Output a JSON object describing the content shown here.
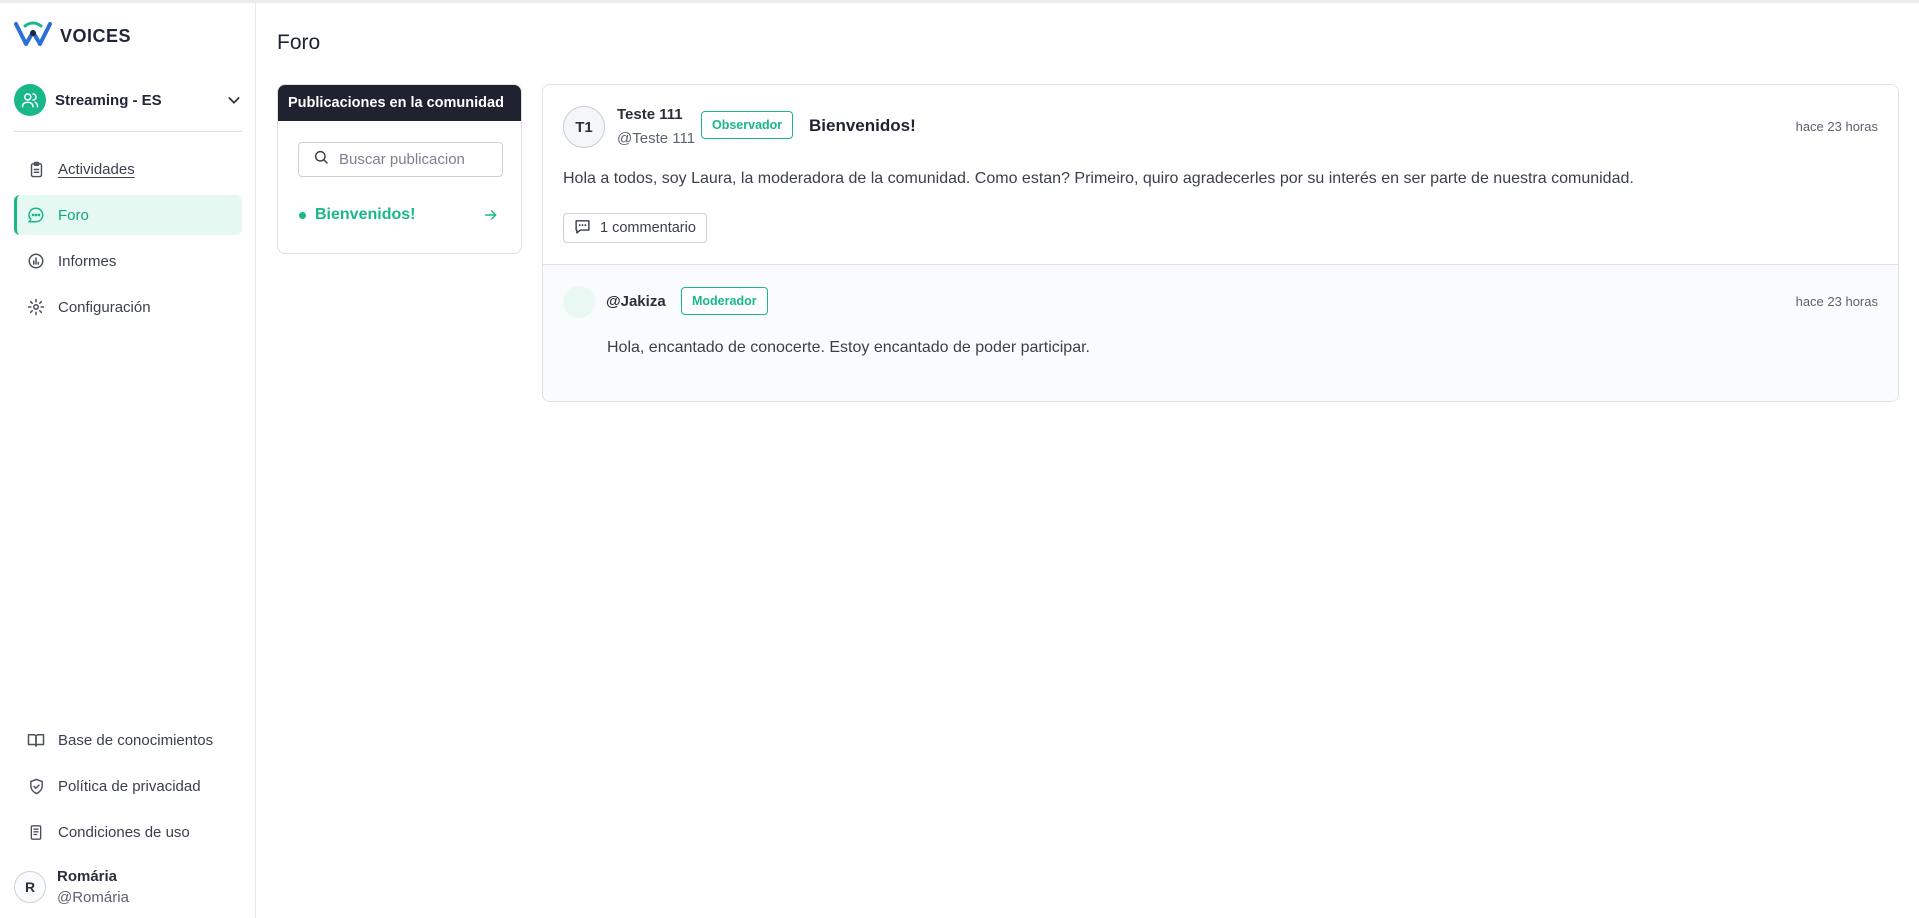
{
  "app": {
    "brand": "VOICES",
    "accent": "#19b78a",
    "dark": "#1f2330"
  },
  "sidebar": {
    "workspace": {
      "name": "Streaming - ES",
      "icon": "users-icon"
    },
    "nav": [
      {
        "label": "Actividades",
        "icon": "clipboard-icon",
        "active": false
      },
      {
        "label": "Foro",
        "icon": "chat-bubble-icon",
        "active": true
      },
      {
        "label": "Informes",
        "icon": "chart-circle-icon",
        "active": false
      },
      {
        "label": "Configuración",
        "icon": "gear-icon",
        "active": false
      }
    ],
    "footer_links": [
      {
        "label": "Base de conocimientos",
        "icon": "book-icon"
      },
      {
        "label": "Política de privacidad",
        "icon": "shield-icon"
      },
      {
        "label": "Condiciones de uso",
        "icon": "document-icon"
      }
    ],
    "user": {
      "initial": "R",
      "name": "Romária",
      "handle": "@Romária"
    }
  },
  "main": {
    "title": "Foro",
    "posts_panel": {
      "header": "Publicaciones en la comunidad",
      "search_placeholder": "Buscar publicacion",
      "items": [
        {
          "title": "Bienvenidos!"
        }
      ]
    },
    "thread": {
      "post": {
        "author_initials": "T1",
        "author_name": "Teste 111",
        "author_handle": "@Teste 111",
        "role": "Observador",
        "title": "Bienvenidos!",
        "time": "hace 23 horas",
        "body": "Hola a todos, soy Laura, la moderadora de la comunidad. Como estan? Primeiro, quiro agradecerles por su interés en ser parte de nuestra comunidad.",
        "comments_label": "1 commentario"
      },
      "reply": {
        "handle": "@Jakiza",
        "role": "Moderador",
        "time": "hace 23 horas",
        "body": "Hola, encantado de conocerte. Estoy encantado de poder participar."
      }
    }
  }
}
